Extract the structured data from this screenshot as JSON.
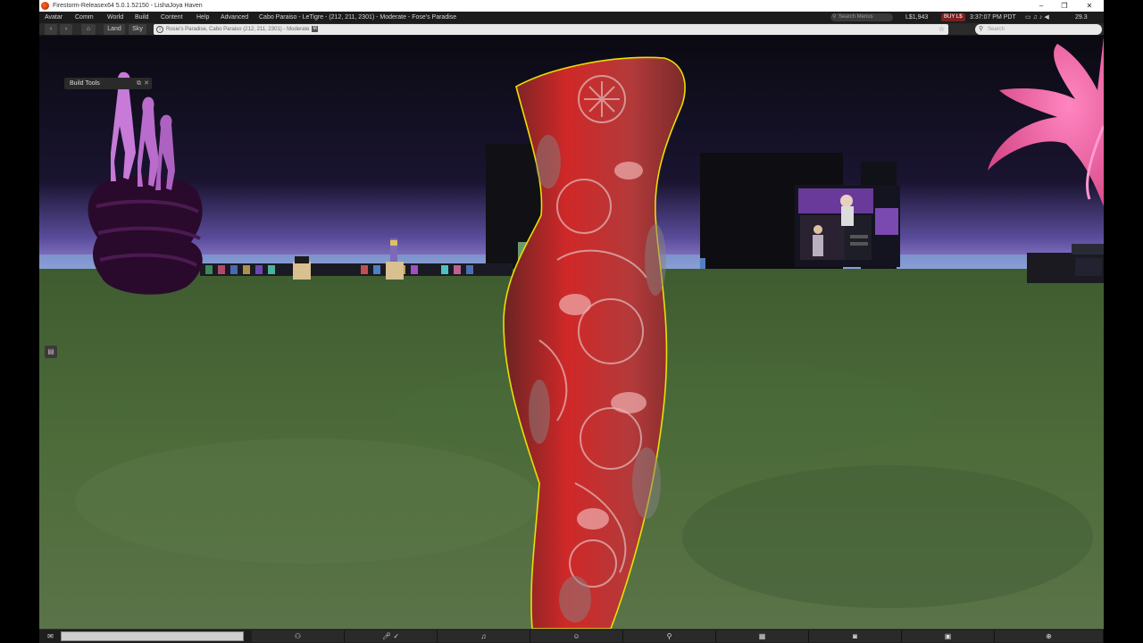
{
  "window": {
    "title": "Firestorm-Releasex64 5.0.1.52150 - LishaJoya Haven",
    "controls": {
      "minimize": "–",
      "restore": "❐",
      "close": "✕"
    }
  },
  "menu": {
    "items": [
      "Avatar",
      "Comm",
      "World",
      "Build",
      "Content",
      "Help",
      "Advanced"
    ],
    "region_info": "Cabo Paraiso - LeTigre - (212, 211, 2301) - Moderate - Fose's Paradise",
    "search_placeholder": "Search Menus",
    "balance": "L$1,943",
    "buy_label": "BUY L$",
    "clock": "3:37:07 PM PDT",
    "fps": "29.3"
  },
  "nav": {
    "back": "‹",
    "forward": "›",
    "home": "⌂",
    "land_label": "Land",
    "sky_label": "Sky",
    "location": "Rosie's Paradise, Cabo Paraiso (212, 211, 2301) - Moderate",
    "maturity_badge": "M",
    "search_placeholder": "Search"
  },
  "build_tools": {
    "label": "Build Tools"
  },
  "bottom_bar": {
    "chat_icon": "chat-bubble-icon",
    "buttons": [
      "people-icon",
      "microphone-icon",
      "headset-icon",
      "avatar-icon",
      "search-icon",
      "map-icon",
      "camera-icon",
      "inventory-icon",
      "world-icon"
    ]
  },
  "colors": {
    "dress_red": "#d42a2a",
    "selection_outline": "#e8e000",
    "ground": "#4b6b36",
    "sky_glow": "#8a78c8",
    "pink_plant": "#ff6fb0",
    "statue": "#c77ad8"
  }
}
